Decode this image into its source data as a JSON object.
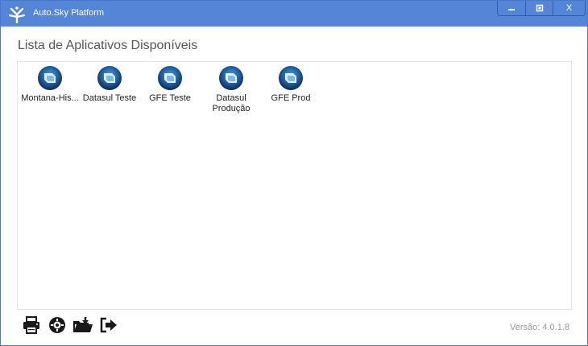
{
  "window": {
    "title": "Auto.Sky Platform",
    "controls": {
      "minimize": "▬",
      "maximize": "▢",
      "close": "X"
    }
  },
  "main": {
    "heading": "Lista de Aplicativos Disponíveis",
    "apps": [
      {
        "label": "Montana-His...",
        "icon": "app-icon"
      },
      {
        "label": "Datasul Teste",
        "icon": "app-icon"
      },
      {
        "label": "GFE Teste",
        "icon": "app-icon"
      },
      {
        "label": "Datasul Produção",
        "icon": "app-icon"
      },
      {
        "label": "GFE Prod",
        "icon": "app-icon"
      }
    ]
  },
  "toolbar": {
    "icons": [
      "printer-icon",
      "gear-icon",
      "folder-download-icon",
      "sign-out-icon"
    ]
  },
  "footer": {
    "version": "Versão: 4.0.1.8"
  },
  "colors": {
    "titlebar": "#5585d6",
    "border": "#4a78c8",
    "heading": "#555555",
    "version": "#9a9a9a"
  }
}
